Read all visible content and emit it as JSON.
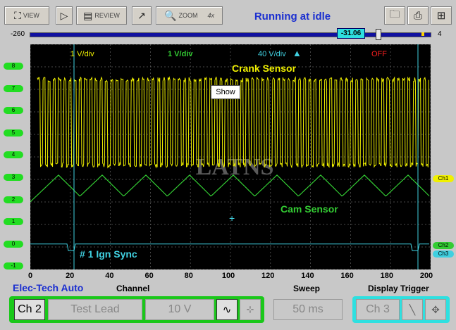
{
  "toolbar": {
    "view_label": "VIEW",
    "review_label": "REVIEW",
    "zoom_label": "ZOOM",
    "zoom_level": "4x"
  },
  "status_title": "Running at idle",
  "time_scroll": {
    "min_label": "-260",
    "max_label": "4",
    "cursor_value": "-31.06"
  },
  "scope": {
    "ch1_scale": "1 V/div",
    "ch2_scale": "1 V/div",
    "ch3_scale": "40 V/div",
    "ch4_state": "OFF",
    "tooltip": "Show",
    "watermark": "LATNS",
    "trace_labels": {
      "crank": "Crank Sensor",
      "cam": "Cam Sensor",
      "ign": "# 1 Ign Sync"
    },
    "y_ticks": [
      "8",
      "7",
      "6",
      "5",
      "4",
      "3",
      "2",
      "1",
      "0",
      "-1"
    ],
    "x_ticks": [
      "0",
      "20",
      "40",
      "60",
      "80",
      "100",
      "120",
      "140",
      "160",
      "180",
      "200"
    ],
    "channel_tags": [
      "Ch1",
      "Ch2",
      "Ch3"
    ],
    "colors": {
      "crank": "#f0f000",
      "cam": "#33cc33",
      "ign": "#40d0e0",
      "off": "#ff2020"
    }
  },
  "bottom": {
    "brand": "Elec-Tech Auto",
    "channel_group_label": "Channel",
    "sweep_group_label": "Sweep",
    "trigger_group_label": "Display Trigger",
    "channel_select": "Ch 2",
    "lead_type": "Test Lead",
    "voltage_range": "10 V",
    "sweep_value": "50 ms",
    "trigger_channel": "Ch 3"
  }
}
